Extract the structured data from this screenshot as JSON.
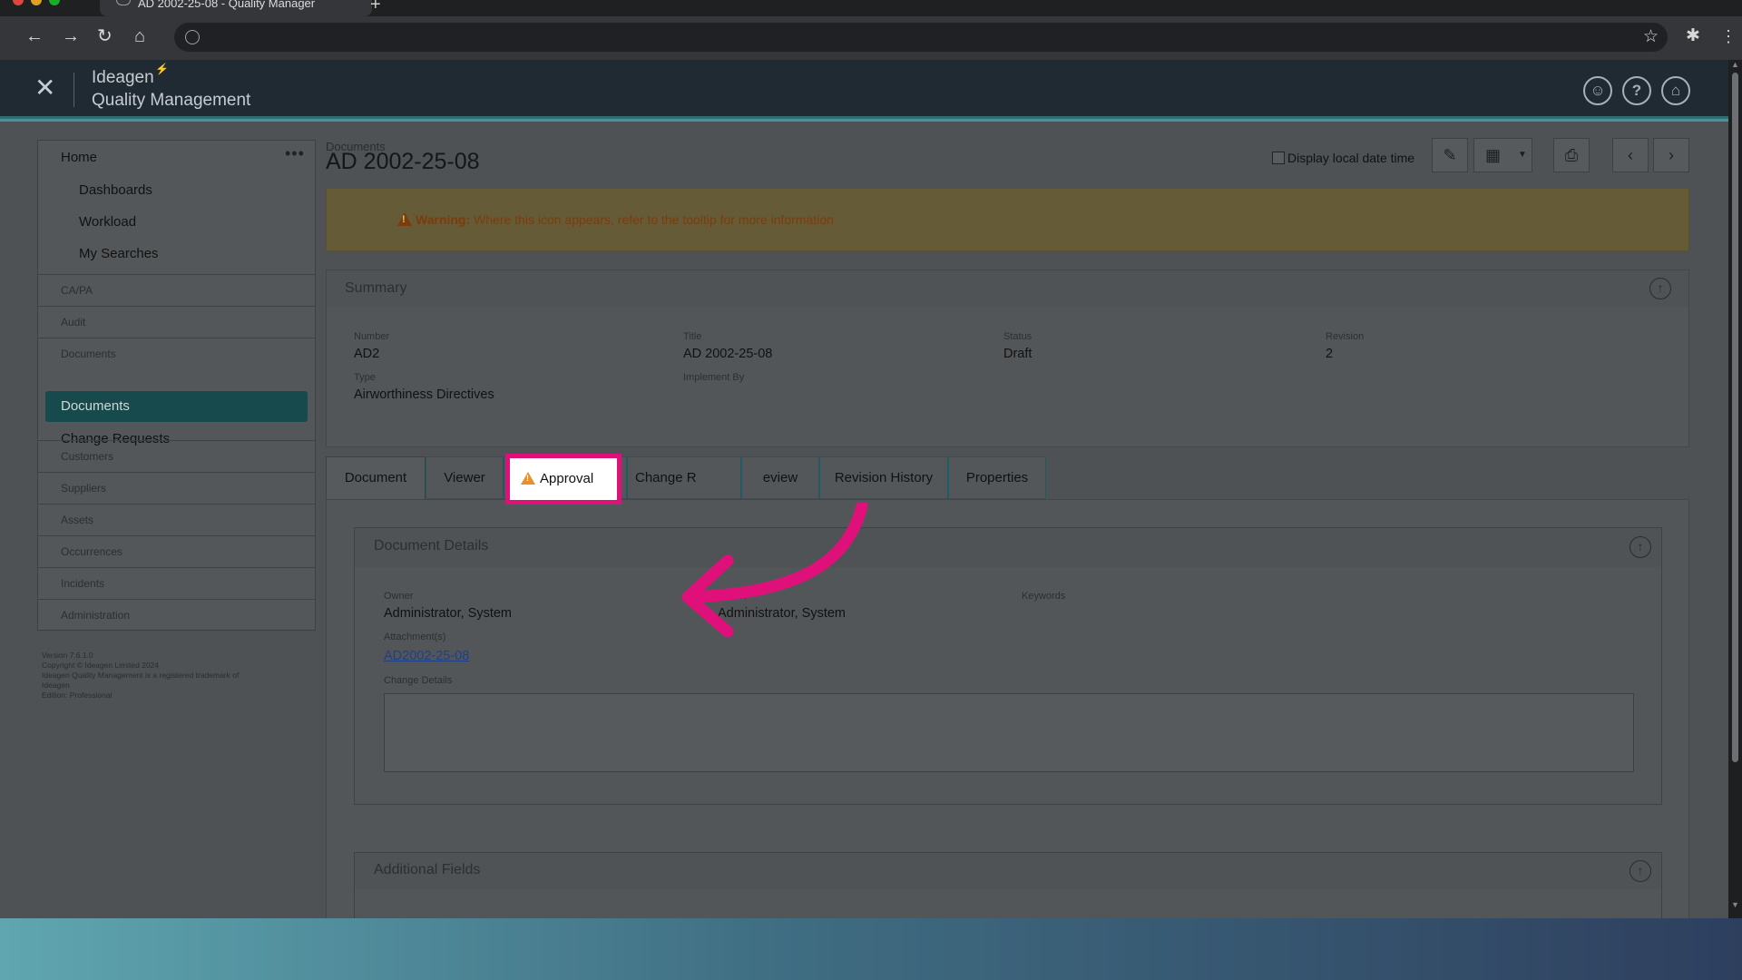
{
  "browser": {
    "tab_title": "AD 2002-25-08 - Quality Manager",
    "new_tab": "+"
  },
  "header": {
    "brand_line1": "Ideagen",
    "brand_line2": "Quality Management",
    "close_label": "✕",
    "icons": [
      "user-icon",
      "help-icon",
      "home-icon"
    ]
  },
  "sidebar": {
    "home": "Home",
    "more": "•••",
    "home_items": [
      "Dashboards",
      "Workload",
      "My Searches"
    ],
    "sections": [
      "CA/PA",
      "Audit",
      "Documents"
    ],
    "active_item": "Documents",
    "doc_items": [
      "Change Requests"
    ],
    "sections_after": [
      "Customers",
      "Suppliers",
      "Assets",
      "Occurrences",
      "Incidents",
      "Administration"
    ],
    "version_lines": [
      "Version 7.6.1.0",
      "Copyright © Ideagen Limited 2024",
      "Ideagen Quality Management is a registered trademark of",
      "Ideagen",
      "Edition: Professional"
    ]
  },
  "page": {
    "breadcrumb": "Documents",
    "title": "AD 2002-25-08",
    "display_local_date_time": "Display local date time"
  },
  "warning": {
    "label": "Warning:",
    "text": "Where this icon appears, refer to the tooltip for more information"
  },
  "summary": {
    "title": "Summary",
    "number_label": "Number",
    "number_value": "AD2",
    "title_label": "Title",
    "title_value": "AD 2002-25-08",
    "status_label": "Status",
    "status_value": "Draft",
    "revision_label": "Revision",
    "revision_value": "2",
    "type_label": "Type",
    "type_value": "Airworthiness Directives",
    "implement_by_label": "Implement By"
  },
  "tabs": {
    "document": "Document",
    "viewer": "Viewer",
    "approval": "Approval",
    "change_partial": "Change R",
    "review_partial": "eview",
    "revision_history": "Revision History",
    "properties": "Properties"
  },
  "document_details": {
    "title": "Document Details",
    "owner_label": "Owner",
    "owner_value": "Administrator, System",
    "author_label": "Author",
    "author_value": "Administrator, System",
    "keywords_label": "Keywords",
    "attachments_label": "Attachment(s)",
    "attachment_link": "AD2002-25-08",
    "change_details_label": "Change Details"
  },
  "additional_fields": {
    "title": "Additional Fields"
  },
  "colors": {
    "highlight": "#e0107a",
    "active_nav": "#174a4c",
    "warning_bg": "#665b37"
  }
}
